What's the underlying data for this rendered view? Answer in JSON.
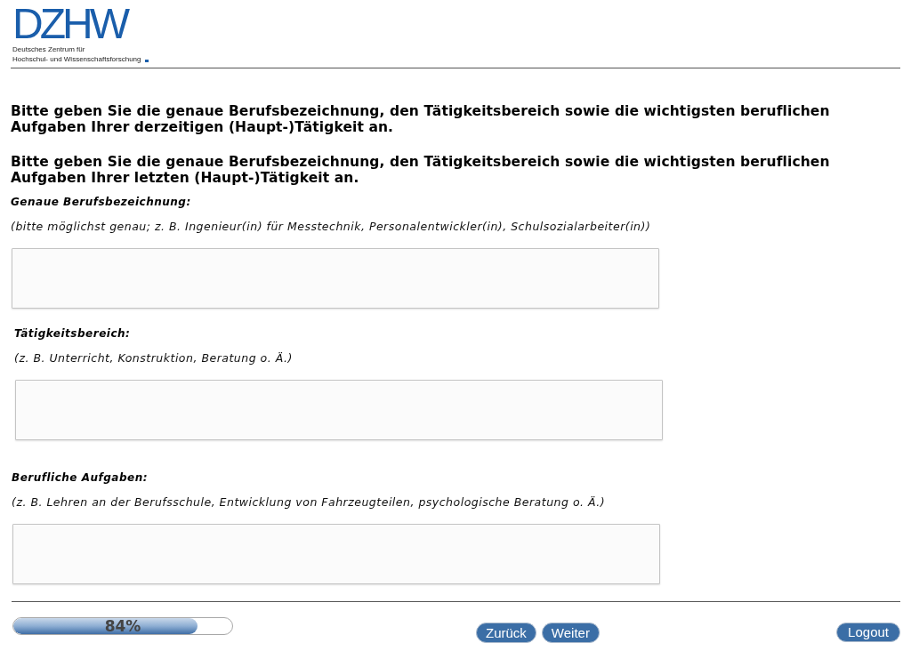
{
  "logo": {
    "wordmark": "DZHW",
    "tagline": [
      "Deutsches Zentrum für",
      "Hochschul- und Wissenschaftsforschung"
    ]
  },
  "instructions": [
    "Bitte geben Sie die genaue Berufsbezeichnung, den Tätigkeitsbereich sowie die wichtigsten beruflichen Aufgaben Ihrer derzeitigen (Haupt-)Tätigkeit an.",
    "Bitte geben Sie die genaue Berufsbezeichnung, den Tätigkeitsbereich sowie die wichtigsten beruflichen Aufgaben Ihrer letzten (Haupt-)Tätigkeit an."
  ],
  "fields": [
    {
      "label": "Genaue Berufsbezeichnung:",
      "hint": "(bitte möglichst genau; z. B. Ingenieur(in) für Messtechnik, Personalentwickler(in), Schulsozialarbeiter(in))"
    },
    {
      "label": "Tätigkeitsbereich:",
      "hint": "(z. B. Unterricht, Konstruktion, Beratung o. Ä.)"
    },
    {
      "label": "Berufliche Aufgaben:",
      "hint": "(z. B. Lehren an der Berufsschule, Entwicklung von Fahrzeugteilen, psychologische Beratung o. Ä.)"
    }
  ],
  "progress": {
    "level": 0.84,
    "reading": "84%"
  },
  "navigation": [
    "Zurück",
    "Weiter"
  ],
  "logout": "Logout"
}
